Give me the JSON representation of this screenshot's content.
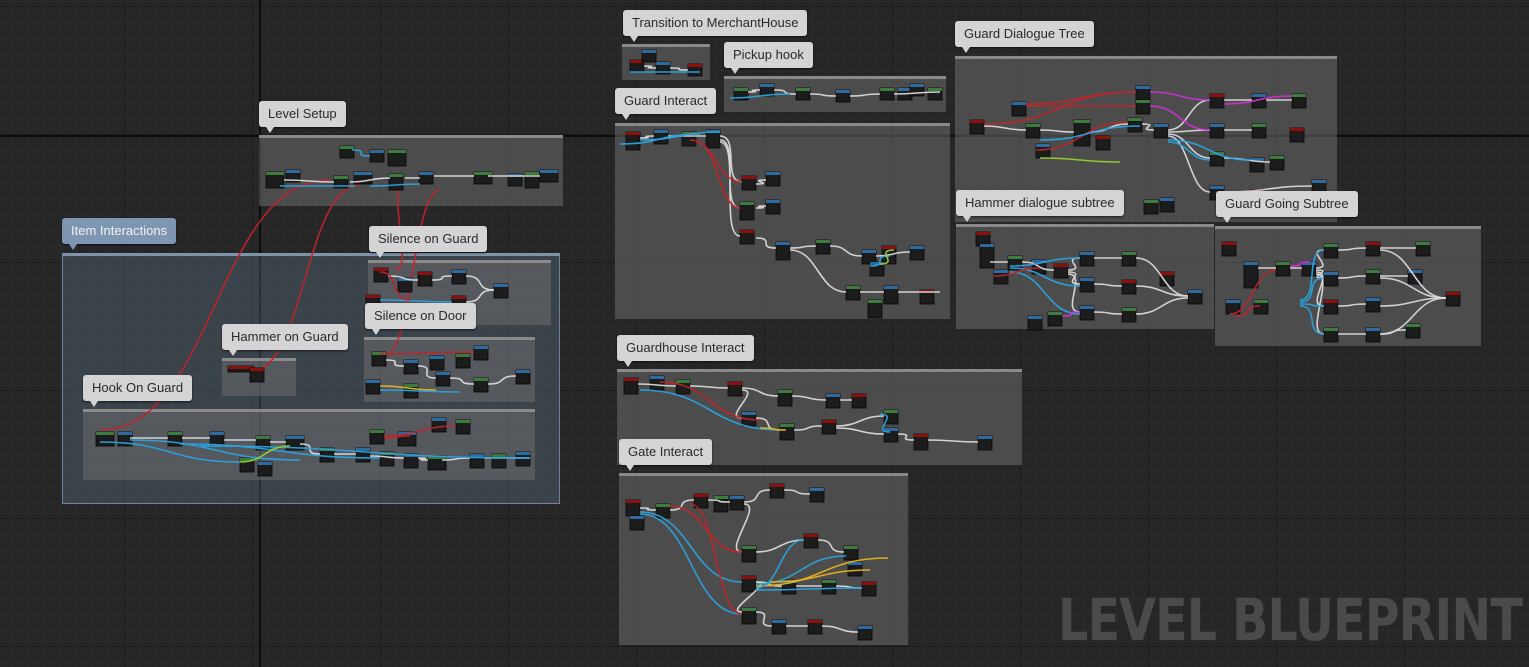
{
  "editor": {
    "watermark": "LEVEL BLUEPRINT"
  },
  "comments": {
    "transition_to_merchant_house": "Transition to MerchantHouse",
    "pickup_hook": "Pickup hook",
    "guard_interact": "Guard Interact",
    "guard_dialogue_tree": "Guard Dialogue Tree",
    "level_setup": "Level Setup",
    "item_interactions": "Item Interactions",
    "silence_on_guard": "Silence on Guard",
    "silence_on_door": "Silence on Door",
    "hammer_on_guard": "Hammer on Guard",
    "hook_on_guard": "Hook On Guard",
    "hammer_dialogue_subtree": "Hammer dialogue subtree",
    "guard_going_subtree": "Guard Going Subtree",
    "guardhouse_interact": "Guardhouse Interact",
    "gate_interact": "Gate Interact"
  },
  "colors": {
    "canvas": "#262626",
    "comment_box": "#6c6c6c",
    "group_box": "#6e8caa",
    "exec_wire": "#d9d9d9",
    "wire_red": "#c0242a",
    "wire_blue": "#2aa3e0",
    "wire_magenta": "#d02ed4",
    "wire_yellow": "#e6b420",
    "wire_green": "#9acd32",
    "node_body": "#1c1c1c",
    "node_header_red": "#8a1010",
    "node_header_green": "#3d7a3d",
    "node_header_blue": "#2f6a9e"
  }
}
